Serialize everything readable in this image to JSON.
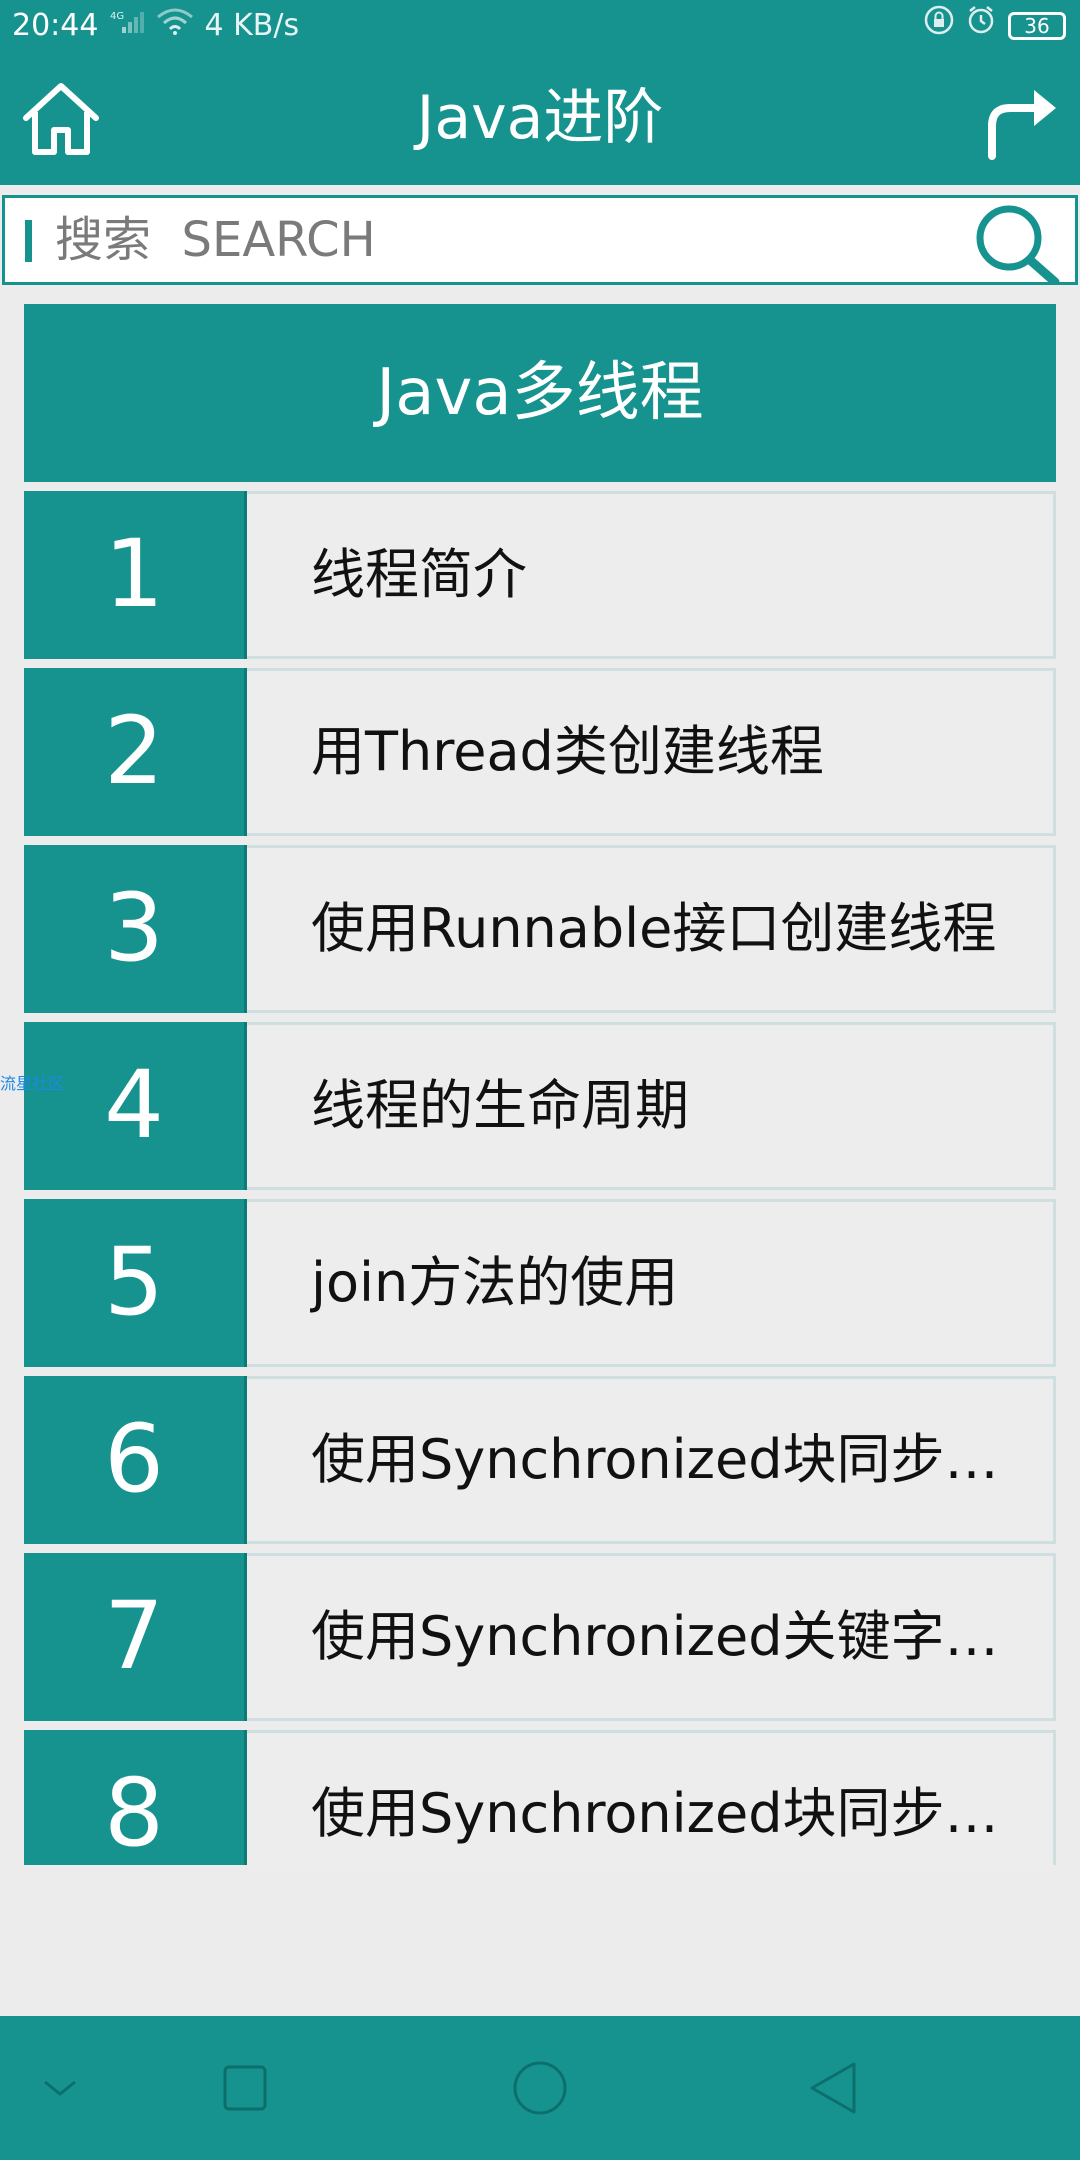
{
  "status_bar": {
    "time": "20:44",
    "network": "4G",
    "speed": "4 KB/s",
    "battery": "36",
    "icons": [
      "signal-icon",
      "wifi-icon",
      "lock-icon",
      "alarm-icon",
      "battery-icon"
    ]
  },
  "app_bar": {
    "title": "Java进阶",
    "left_icon": "home-icon",
    "right_icon": "share-icon"
  },
  "search": {
    "placeholder": "搜索  SEARCH",
    "icon": "search-icon"
  },
  "section": {
    "title": "Java多线程"
  },
  "lessons": [
    {
      "number": "1",
      "title": "线程简介"
    },
    {
      "number": "2",
      "title": "用Thread类创建线程"
    },
    {
      "number": "3",
      "title": "使用Runnable接口创建线程"
    },
    {
      "number": "4",
      "title": "线程的生命周期"
    },
    {
      "number": "5",
      "title": "join方法的使用"
    },
    {
      "number": "6",
      "title": "使用Synchronized块同步方法"
    },
    {
      "number": "7",
      "title": "使用Synchronized关键字同步方法"
    },
    {
      "number": "8",
      "title": "使用Synchronized块同步变量"
    }
  ],
  "watermark": "流星社区",
  "nav_bar": {
    "icons": [
      "collapse-icon",
      "recents-icon",
      "home-circle-icon",
      "back-icon"
    ]
  },
  "colors": {
    "primary": "#16938f",
    "background": "#ececec",
    "item_background": "#ededed"
  }
}
